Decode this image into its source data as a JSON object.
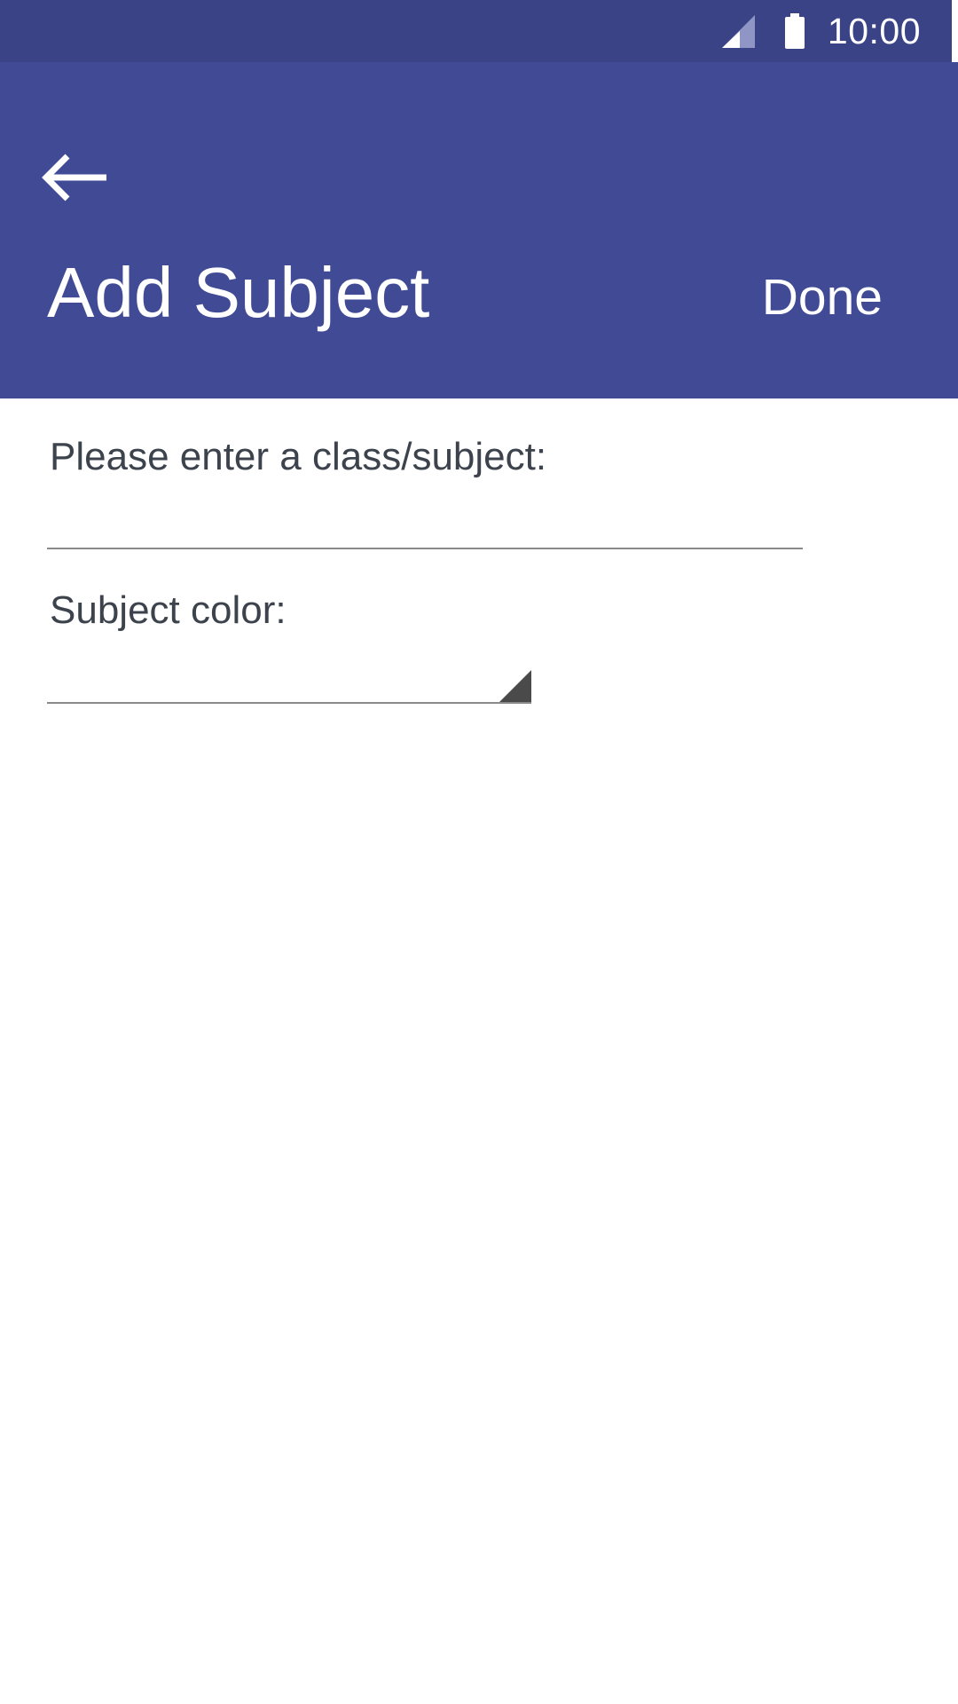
{
  "status_bar": {
    "time": "10:00",
    "signal_icon": "signal-icon",
    "battery_icon": "battery-icon",
    "background_color": "#3a4386"
  },
  "app_bar": {
    "back_icon": "arrow-left-icon",
    "title": "Add Subject",
    "done_label": "Done",
    "background_color": "#404a95"
  },
  "form": {
    "subject_label": "Please enter a class/subject:",
    "subject_value": "",
    "color_label": "Subject color:",
    "color_value": ""
  }
}
